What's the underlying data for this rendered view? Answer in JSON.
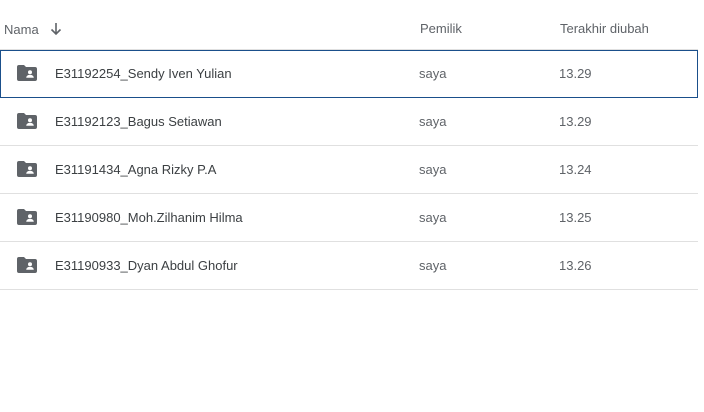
{
  "header": {
    "name_label": "Nama",
    "sort_icon": "arrow-down-icon",
    "owner_label": "Pemilik",
    "modified_label": "Terakhir diubah"
  },
  "colors": {
    "selected_border": "#1a4f8b",
    "folder_icon": "#5f6368",
    "divider": "#e0e0e0"
  },
  "rows": [
    {
      "icon": "shared-folder-icon",
      "name": "E31192254_Sendy Iven Yulian",
      "owner": "saya",
      "modified": "13.29"
    },
    {
      "icon": "shared-folder-icon",
      "name": "E31192123_Bagus Setiawan",
      "owner": "saya",
      "modified": "13.29"
    },
    {
      "icon": "shared-folder-icon",
      "name": "E31191434_Agna Rizky P.A",
      "owner": "saya",
      "modified": "13.24"
    },
    {
      "icon": "shared-folder-icon",
      "name": "E31190980_Moh.Zilhanim Hilma",
      "owner": "saya",
      "modified": "13.25"
    },
    {
      "icon": "shared-folder-icon",
      "name": "E31190933_Dyan Abdul Ghofur",
      "owner": "saya",
      "modified": "13.26"
    }
  ]
}
